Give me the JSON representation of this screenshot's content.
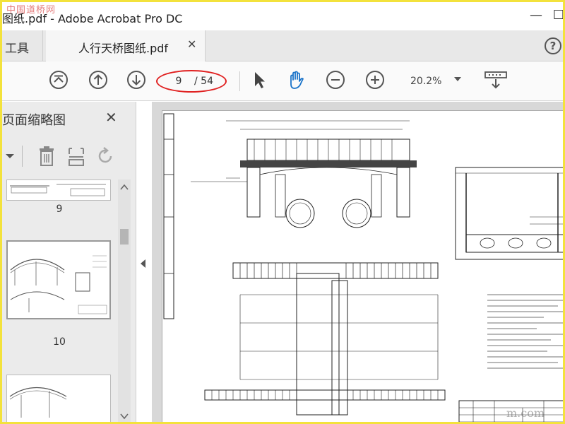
{
  "window": {
    "watermark": "中国道桥网",
    "title": "图纸.pdf - Adobe Acrobat Pro DC",
    "minimize": "—",
    "maximize": "☐"
  },
  "tabs": {
    "tools_label": "工具",
    "doc_label": "人行天桥图纸.pdf",
    "close_glyph": "✕",
    "help_glyph": "?"
  },
  "toolbar": {
    "page_current": "9",
    "page_total": "/ 54",
    "zoom": "20.2%"
  },
  "panel": {
    "title": "页面缩略图",
    "close_glyph": "✕",
    "thumb_labels": [
      "9",
      "10"
    ]
  },
  "watermark_bottom": "m.com",
  "colors": {
    "accent": "#1a73c9",
    "highlight": "#e02020",
    "frame": "#f3e23c"
  }
}
